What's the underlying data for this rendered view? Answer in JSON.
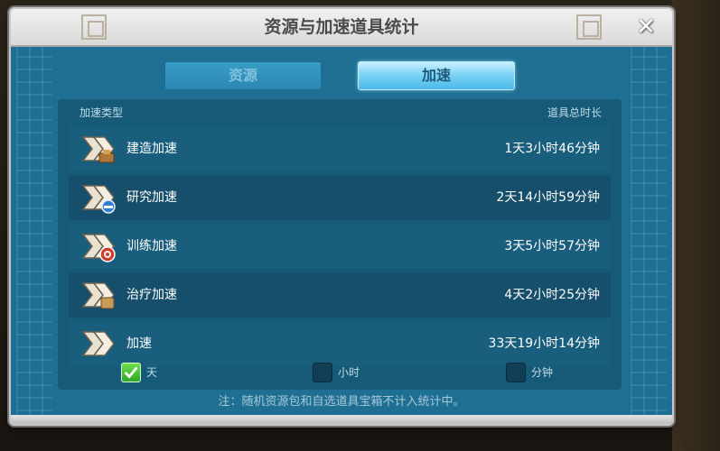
{
  "dialog": {
    "title": "资源与加速道具统计",
    "close_symbol": "✕"
  },
  "tabs": [
    {
      "label": "资源",
      "active": false
    },
    {
      "label": "加速",
      "active": true
    }
  ],
  "list": {
    "header_type": "加速类型",
    "header_duration": "道具总时长",
    "rows": [
      {
        "icon": "speedup-build-icon",
        "label": "建造加速",
        "value": "1天3小时46分钟"
      },
      {
        "icon": "speedup-research-icon",
        "label": "研究加速",
        "value": "2天14小时59分钟"
      },
      {
        "icon": "speedup-training-icon",
        "label": "训练加速",
        "value": "3天5小时57分钟"
      },
      {
        "icon": "speedup-healing-icon",
        "label": "治疗加速",
        "value": "4天2小时25分钟"
      },
      {
        "icon": "speedup-universal-icon",
        "label": "加速",
        "value": "33天19小时14分钟"
      }
    ]
  },
  "units": [
    {
      "label": "天",
      "checked": true
    },
    {
      "label": "小时",
      "checked": false
    },
    {
      "label": "分钟",
      "checked": false
    }
  ],
  "footnote": "注：随机资源包和自选道具宝箱不计入统计中。",
  "colors": {
    "panel": "#1f6f92",
    "tab_active": "#7fd4f6",
    "check_green": "#2fa82a"
  }
}
